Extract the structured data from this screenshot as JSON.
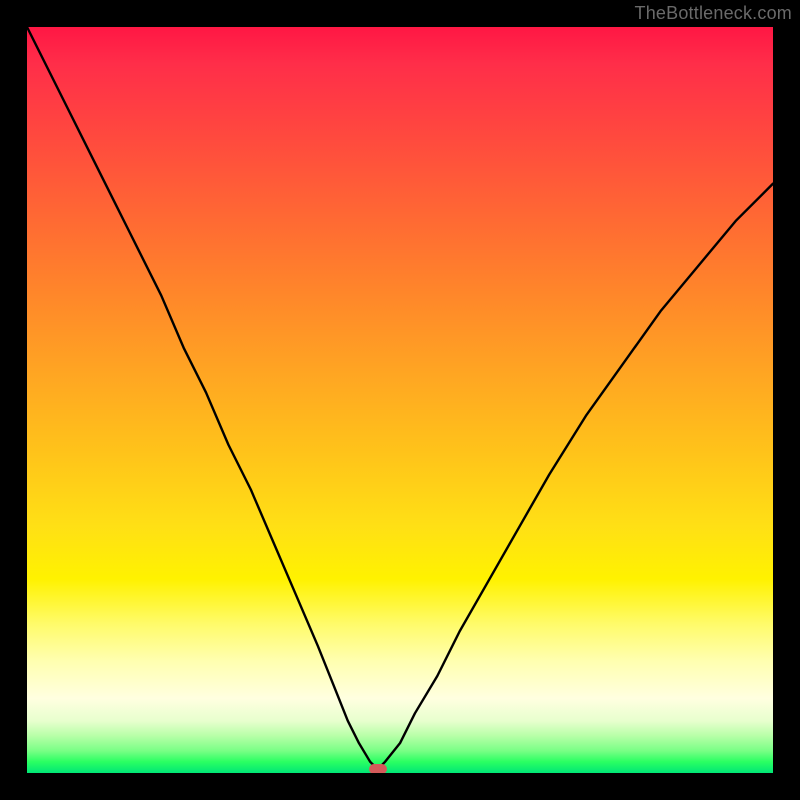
{
  "watermark": {
    "text": "TheBottleneck.com"
  },
  "colors": {
    "frame": "#000000",
    "curve": "#000000",
    "min_marker": "#d45a5a",
    "gradient_top": "#ff1744",
    "gradient_mid": "#ffe015",
    "gradient_bottom": "#00e676"
  },
  "chart_data": {
    "type": "line",
    "title": "",
    "xlabel": "",
    "ylabel": "",
    "xlim": [
      0,
      100
    ],
    "ylim": [
      0,
      100
    ],
    "legend": false,
    "grid": false,
    "series": [
      {
        "name": "bottleneck-curve",
        "x": [
          0,
          3,
          6,
          9,
          12,
          15,
          18,
          21,
          24,
          27,
          30,
          33,
          36,
          39,
          41,
          43,
          44.5,
          46,
          47,
          48,
          50,
          52,
          55,
          58,
          62,
          66,
          70,
          75,
          80,
          85,
          90,
          95,
          100
        ],
        "y": [
          100,
          94,
          88,
          82,
          76,
          70,
          64,
          57,
          51,
          44,
          38,
          31,
          24,
          17,
          12,
          7,
          4,
          1.5,
          0.5,
          1.5,
          4,
          8,
          13,
          19,
          26,
          33,
          40,
          48,
          55,
          62,
          68,
          74,
          79
        ]
      }
    ],
    "annotations": [
      {
        "name": "minimum-marker",
        "x": 47,
        "y": 0.5
      }
    ]
  }
}
